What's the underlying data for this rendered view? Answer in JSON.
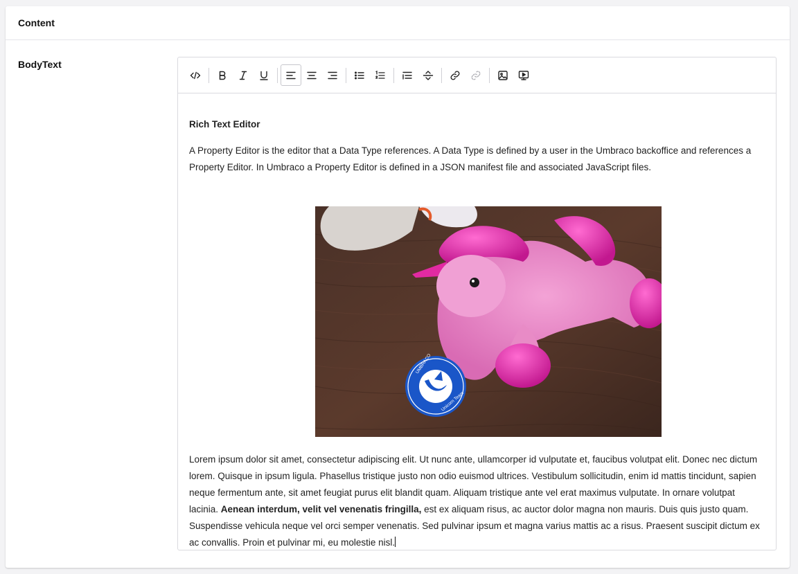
{
  "card": {
    "title": "Content"
  },
  "property": {
    "label": "BodyText"
  },
  "toolbar": {
    "buttons": [
      {
        "name": "source-code-icon",
        "group": 1
      },
      {
        "name": "bold-icon",
        "group": 2
      },
      {
        "name": "italic-icon",
        "group": 2
      },
      {
        "name": "underline-icon",
        "group": 2
      },
      {
        "name": "align-left-icon",
        "group": 3,
        "active": true
      },
      {
        "name": "align-center-icon",
        "group": 3
      },
      {
        "name": "align-right-icon",
        "group": 3
      },
      {
        "name": "bullet-list-icon",
        "group": 4
      },
      {
        "name": "numbered-list-icon",
        "group": 4
      },
      {
        "name": "blockquote-icon",
        "group": 5
      },
      {
        "name": "horizontal-rule-icon",
        "group": 5
      },
      {
        "name": "link-icon",
        "group": 6
      },
      {
        "name": "unlink-icon",
        "group": 6,
        "disabled": true
      },
      {
        "name": "insert-image-icon",
        "group": 7
      },
      {
        "name": "embed-media-icon",
        "group": 7
      }
    ]
  },
  "editor": {
    "heading": "Rich Text Editor",
    "paragraph1": "A Property Editor is the editor that a Data Type references. A Data Type is defined by a user in the Umbraco backoffice and references a Property Editor. In Umbraco a Property Editor is defined in a JSON manifest file and associated JavaScript files.",
    "image_alt": "Pink plush unicorn on wooden table with Umbraco Unicorn Team badge",
    "badge_text_top": "UMBRACO",
    "badge_text_bottom": "Unicorn Team",
    "paragraph2_start": "Lorem ipsum dolor sit amet, consectetur adipiscing elit. Ut nunc ante, ullamcorper id vulputate et, faucibus volutpat elit. Donec nec dictum lorem. Quisque in ipsum ligula. Phasellus tristique justo non odio euismod ultrices. Vestibulum sollicitudin, enim id mattis tincidunt, sapien neque fermentum ante, sit amet feugiat purus elit blandit quam. Aliquam tristique ante vel erat maximus vulputate. In ornare volutpat lacinia. ",
    "paragraph2_bold": "Aenean interdum, velit vel venenatis fringilla,",
    "paragraph2_end": " est ex aliquam risus, ac auctor dolor magna non mauris. Duis quis justo quam. Suspendisse vehicula neque vel orci semper venenatis. Sed pulvinar ipsum et magna varius mattis ac a risus. Praesent suscipit dictum ex ac convallis. Proin et pulvinar mi, eu molestie nisl."
  }
}
